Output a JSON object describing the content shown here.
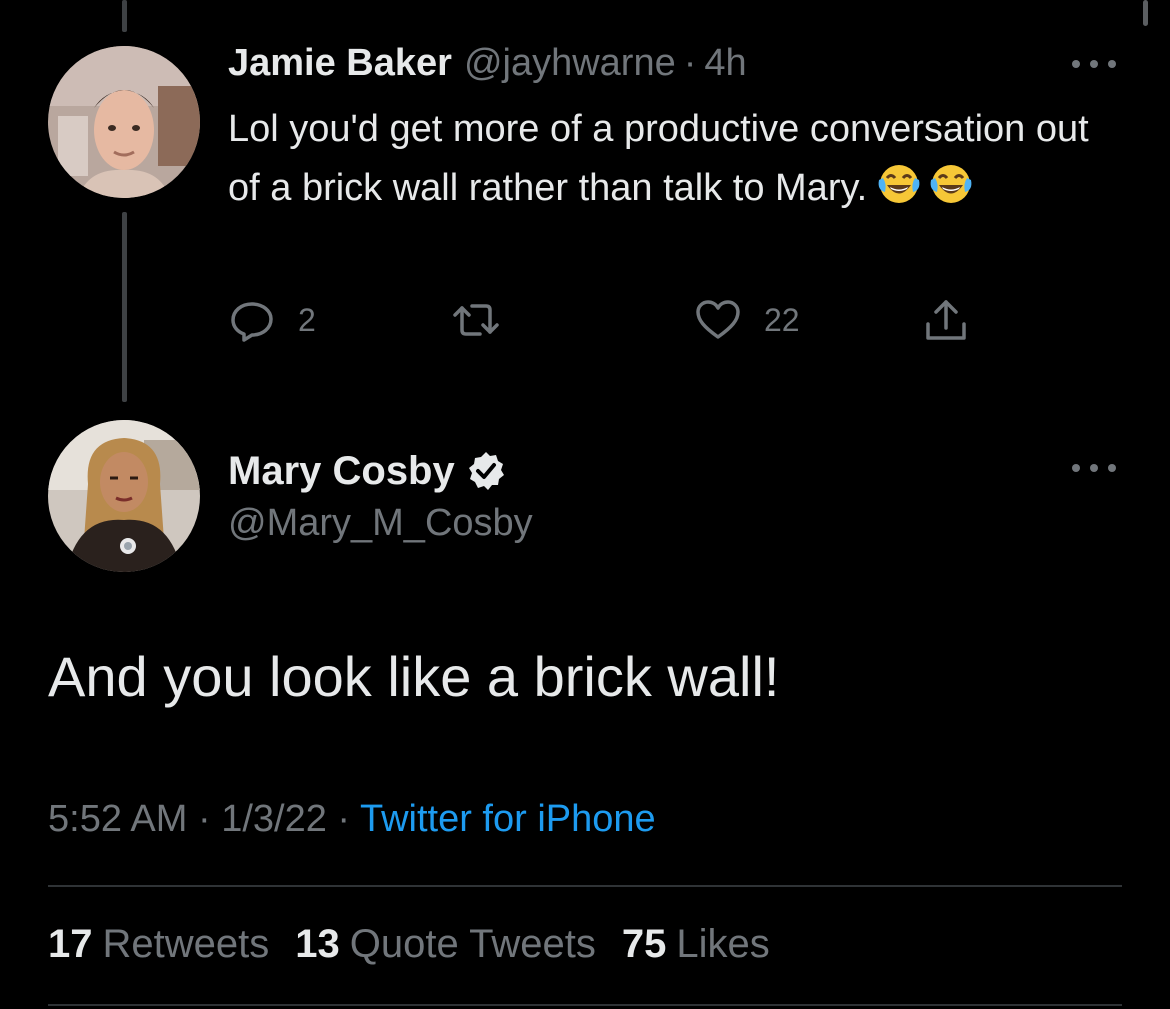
{
  "parent_tweet": {
    "name": "Jamie Baker",
    "handle": "@jayhwarne",
    "separator": "·",
    "time": "4h",
    "text": "Lol you'd get more of a productive conversation out of a brick wall rather than talk to Mary.",
    "emoji": [
      "face-with-tears-of-joy",
      "face-with-tears-of-joy"
    ],
    "reply_count": "2",
    "retweet_count": "",
    "like_count": "22"
  },
  "main_tweet": {
    "name": "Mary Cosby",
    "verified": true,
    "handle": "@Mary_M_Cosby",
    "text": "And you look like a brick wall!",
    "time": "5:52 AM",
    "date": "1/3/22",
    "separator": "·",
    "source": "Twitter for iPhone",
    "stats": {
      "retweets_count": "17",
      "retweets_label": "Retweets",
      "quotes_count": "13",
      "quotes_label": "Quote Tweets",
      "likes_count": "75",
      "likes_label": "Likes"
    }
  },
  "colors": {
    "background": "#000000",
    "text_primary": "#e7e9ea",
    "text_secondary": "#71767b",
    "link": "#1d9bf0",
    "divider": "#2f3336"
  }
}
